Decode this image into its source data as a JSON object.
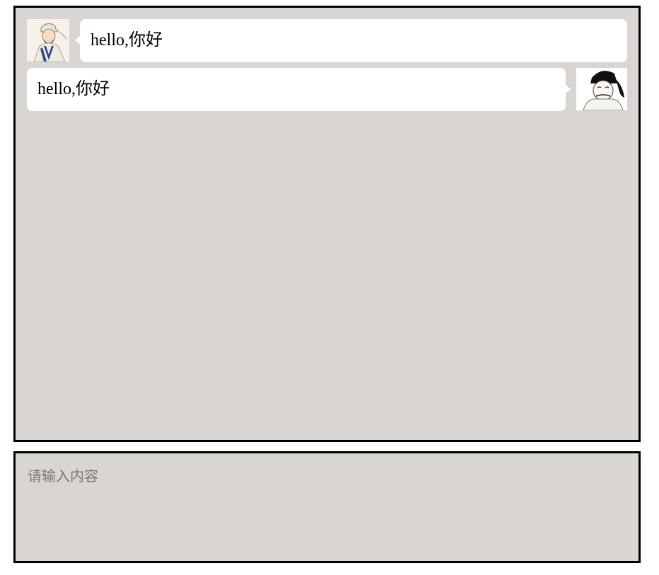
{
  "messages": [
    {
      "side": "left",
      "avatar_icon": "scholar-portrait-icon",
      "text": "hello,你好"
    },
    {
      "side": "right",
      "avatar_icon": "emperor-portrait-icon",
      "text": "hello,你好"
    }
  ],
  "input": {
    "placeholder": "请输入内容",
    "value": ""
  },
  "colors": {
    "background": "#d8d5d3",
    "bubble": "#ffffff",
    "border": "#000000",
    "placeholder": "#7a7775"
  }
}
